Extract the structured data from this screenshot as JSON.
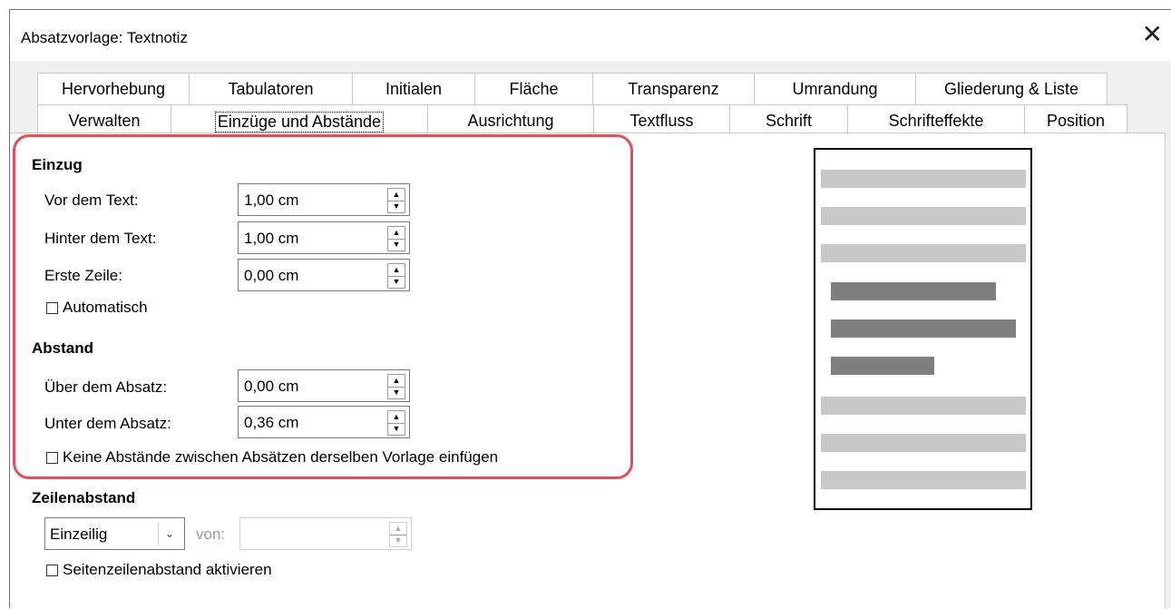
{
  "window": {
    "title": "Absatzvorlage: Textnotiz",
    "close_glyph": "✕"
  },
  "tabs": {
    "row1": [
      "Hervorhebung",
      "Tabulatoren",
      "Initialen",
      "Fläche",
      "Transparenz",
      "Umrandung",
      "Gliederung & Liste"
    ],
    "row2": [
      "Verwalten",
      "Einzüge und Abstände",
      "Ausrichtung",
      "Textfluss",
      "Schrift",
      "Schrifteffekte",
      "Position"
    ],
    "active": "Einzüge und Abstände"
  },
  "indent": {
    "title": "Einzug",
    "before_label": "Vor dem Text:",
    "before_value": "1,00 cm",
    "after_label": "Hinter dem Text:",
    "after_value": "1,00 cm",
    "first_label": "Erste Zeile:",
    "first_value": "0,00 cm",
    "automatic_label": "Automatisch",
    "automatic_checked": false
  },
  "spacing": {
    "title": "Abstand",
    "above_label": "Über dem Absatz:",
    "above_value": "0,00 cm",
    "below_label": "Unter dem Absatz:",
    "below_value": "0,36 cm",
    "no_space_label": "Keine Abstände zwischen Absätzen derselben Vorlage einfügen",
    "no_space_checked": false
  },
  "line_spacing": {
    "title": "Zeilenabstand",
    "mode": "Einzeilig",
    "of_label": "von:",
    "of_value": "",
    "page_line_label": "Seitenzeilenabstand aktivieren",
    "page_line_checked": false
  },
  "colors": {
    "highlight": "#e74c5a",
    "preview_light": "#c8c8c8",
    "preview_dark": "#7f7f7f"
  }
}
